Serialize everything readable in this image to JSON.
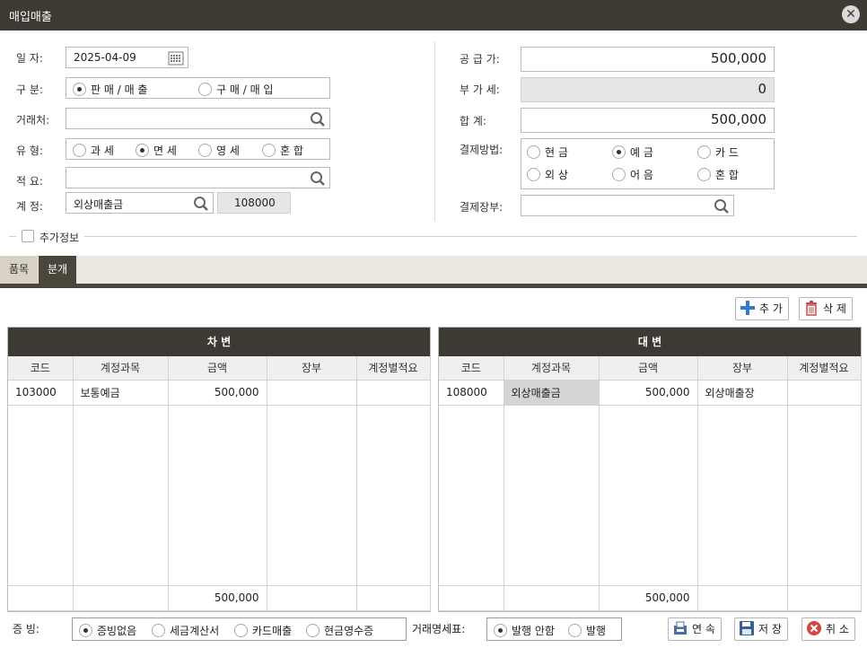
{
  "window": {
    "title": "매입매출"
  },
  "form": {
    "date_label": "일  자:",
    "date_value": "2025-04-09",
    "type_label": "구  분:",
    "type_options": [
      "판 매 / 매 출",
      "구 매 / 매 입"
    ],
    "partner_label": "거래처:",
    "partner_value": "",
    "tax_label": "유  형:",
    "tax_options": [
      "과 세",
      "면 세",
      "영 세",
      "혼 합"
    ],
    "memo_label": "적  요:",
    "memo_value": "",
    "account_label": "계  정:",
    "account_value": "외상매출금",
    "account_code": "108000",
    "supply_label": "공 급 가:",
    "supply_value": "500,000",
    "vat_label": "부 가 세:",
    "vat_value": "0",
    "total_label": "합   계:",
    "total_value": "500,000",
    "pay_label": "결제방법:",
    "pay_options": [
      "현 금",
      "예 금",
      "카 드",
      "외 상",
      "어 음",
      "혼 합"
    ],
    "book_label": "결제장부:",
    "book_value": "",
    "extra_label": "추가정보"
  },
  "tabs": [
    "품목",
    "분개"
  ],
  "actions": {
    "add": "추 가",
    "delete": "삭 제"
  },
  "debit": {
    "title": "차 변",
    "columns": [
      "코드",
      "계정과목",
      "금액",
      "장부",
      "계정별적요"
    ],
    "rows": [
      {
        "code": "103000",
        "account": "보통예금",
        "amount": "500,000",
        "book": "",
        "memo": ""
      }
    ],
    "total": "500,000"
  },
  "credit": {
    "title": "대 변",
    "columns": [
      "코드",
      "계정과목",
      "금액",
      "장부",
      "계정별적요"
    ],
    "rows": [
      {
        "code": "108000",
        "account": "외상매출금",
        "amount": "500,000",
        "book": "외상매출장",
        "memo": ""
      }
    ],
    "total": "500,000"
  },
  "bottom": {
    "evidence_label": "증 빙:",
    "evidence_options": [
      "증빙없음",
      "세금계산서",
      "카드매출",
      "현금영수증"
    ],
    "statement_label": "거래명세표:",
    "statement_options": [
      "발행 안함",
      "발행"
    ],
    "continue": "연 속",
    "save": "저 장",
    "cancel": "취 소"
  },
  "colors": {
    "titlebar": "#3d3a33",
    "tab_active": "#4b463c",
    "tab_bar": "#ece8e1"
  },
  "icons": [
    "close-icon",
    "calendar-icon",
    "search-icon",
    "plus-icon",
    "trash-icon",
    "continue-icon",
    "save-icon",
    "cancel-icon"
  ]
}
